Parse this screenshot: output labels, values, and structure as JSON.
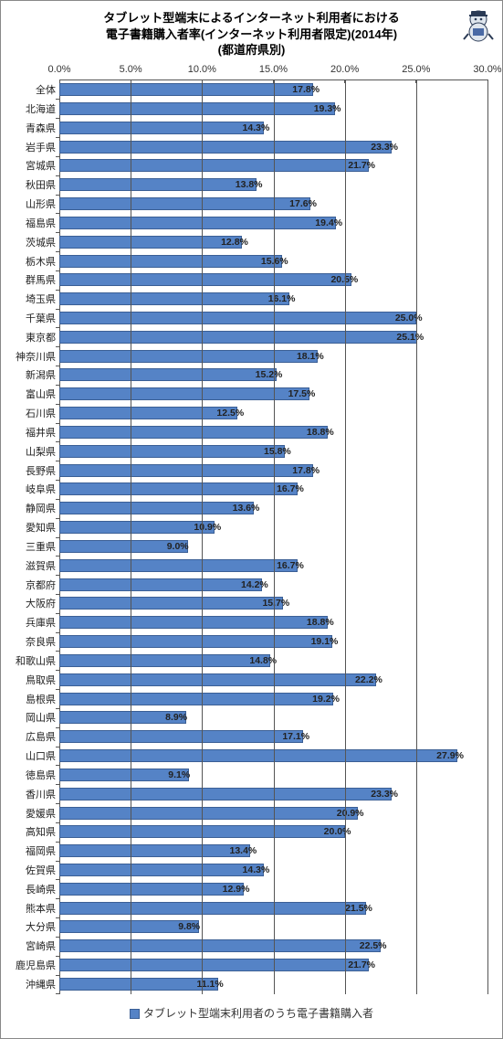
{
  "chart_data": {
    "type": "bar",
    "orientation": "horizontal",
    "title_lines": [
      "タブレット型端末によるインターネット利用者における",
      "電子書籍購入者率(インターネット利用者限定)(2014年)",
      "(都道府県別)"
    ],
    "xlabel": "",
    "ylabel": "",
    "xlim": [
      0,
      30
    ],
    "ticks": [
      0,
      5,
      10,
      15,
      20,
      25,
      30
    ],
    "tick_labels": [
      "0.0%",
      "5.0%",
      "10.0%",
      "15.0%",
      "20.0%",
      "25.0%",
      "30.0%"
    ],
    "legend": "タブレット型端末利用者のうち電子書籍購入者",
    "categories": [
      "全体",
      "北海道",
      "青森県",
      "岩手県",
      "宮城県",
      "秋田県",
      "山形県",
      "福島県",
      "茨城県",
      "栃木県",
      "群馬県",
      "埼玉県",
      "千葉県",
      "東京都",
      "神奈川県",
      "新潟県",
      "富山県",
      "石川県",
      "福井県",
      "山梨県",
      "長野県",
      "岐阜県",
      "静岡県",
      "愛知県",
      "三重県",
      "滋賀県",
      "京都府",
      "大阪府",
      "兵庫県",
      "奈良県",
      "和歌山県",
      "鳥取県",
      "島根県",
      "岡山県",
      "広島県",
      "山口県",
      "徳島県",
      "香川県",
      "愛媛県",
      "高知県",
      "福岡県",
      "佐賀県",
      "長崎県",
      "熊本県",
      "大分県",
      "宮崎県",
      "鹿児島県",
      "沖縄県"
    ],
    "values": [
      17.8,
      19.3,
      14.3,
      23.3,
      21.7,
      13.8,
      17.6,
      19.4,
      12.8,
      15.6,
      20.5,
      16.1,
      25.0,
      25.1,
      18.1,
      15.2,
      17.5,
      12.5,
      18.8,
      15.8,
      17.8,
      16.7,
      13.6,
      10.9,
      9.0,
      16.7,
      14.2,
      15.7,
      18.8,
      19.1,
      14.8,
      22.2,
      19.2,
      8.9,
      17.1,
      27.9,
      9.1,
      23.3,
      20.9,
      20.0,
      13.4,
      14.3,
      12.9,
      21.5,
      9.8,
      22.5,
      21.7,
      11.1
    ],
    "value_labels": [
      "17.8%",
      "19.3%",
      "14.3%",
      "23.3%",
      "21.7%",
      "13.8%",
      "17.6%",
      "19.4%",
      "12.8%",
      "15.6%",
      "20.5%",
      "16.1%",
      "25.0%",
      "25.1%",
      "18.1%",
      "15.2%",
      "17.5%",
      "12.5%",
      "18.8%",
      "15.8%",
      "17.8%",
      "16.7%",
      "13.6%",
      "10.9%",
      "9.0%",
      "16.7%",
      "14.2%",
      "15.7%",
      "18.8%",
      "19.1%",
      "14.8%",
      "22.2%",
      "19.2%",
      "8.9%",
      "17.1%",
      "27.9%",
      "9.1%",
      "23.3%",
      "20.9%",
      "20.0%",
      "13.4%",
      "14.3%",
      "12.9%",
      "21.5%",
      "9.8%",
      "22.5%",
      "21.7%",
      "11.1%"
    ]
  }
}
